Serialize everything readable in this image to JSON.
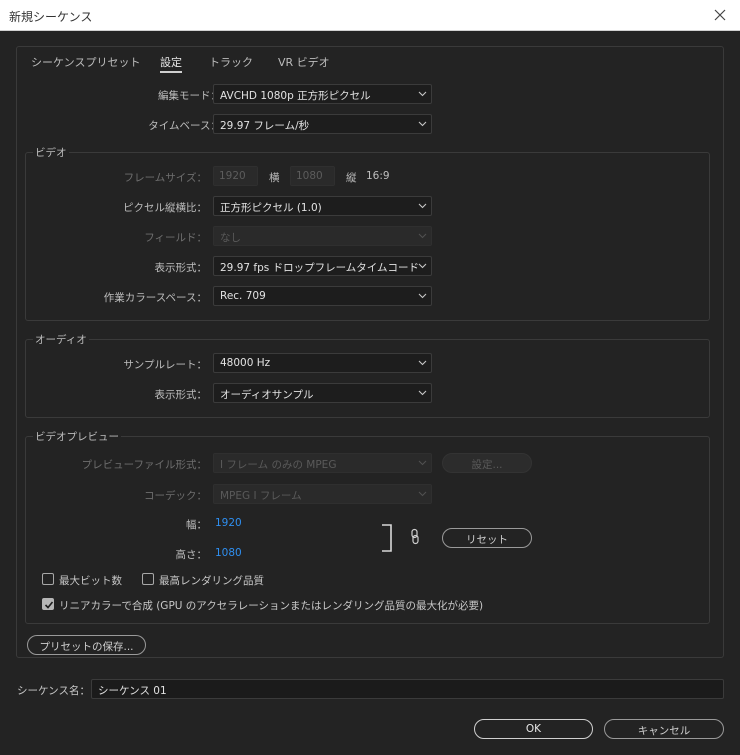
{
  "window": {
    "title": "新規シーケンス"
  },
  "tabs": [
    {
      "label": "シーケンスプリセット"
    },
    {
      "label": "設定"
    },
    {
      "label": "トラック"
    },
    {
      "label": "VR ビデオ"
    }
  ],
  "general": {
    "edit_mode_label": "編集モード：",
    "edit_mode_value": "AVCHD  1080p 正方形ピクセル",
    "timebase_label": "タイムベース：",
    "timebase_value": "29.97  フレーム/秒"
  },
  "video": {
    "title": "ビデオ",
    "frame_size_label": "フレームサイズ：",
    "frame_width": "1920",
    "horizontal_label": "横",
    "frame_height": "1080",
    "vertical_label": "縦",
    "aspect": "16:9",
    "pixel_aspect_label": "ピクセル縦横比：",
    "pixel_aspect_value": "正方形ピクセル (1.0)",
    "field_label": "フィールド：",
    "field_value": "なし",
    "display_format_label": "表示形式：",
    "display_format_value": "29.97  fps ドロップフレームタイムコード",
    "color_space_label": "作業カラースペース：",
    "color_space_value": "Rec. 709"
  },
  "audio": {
    "title": "オーディオ",
    "sample_rate_label": "サンプルレート：",
    "sample_rate_value": "48000 Hz",
    "display_format_label": "表示形式：",
    "display_format_value": "オーディオサンプル"
  },
  "preview": {
    "title": "ビデオプレビュー",
    "file_format_label": "プレビューファイル形式：",
    "file_format_value": "I フレーム のみの MPEG",
    "settings_button": "設定...",
    "codec_label": "コーデック：",
    "codec_value": "MPEG I フレーム",
    "width_label": "幅：",
    "width_value": "1920",
    "height_label": "高さ：",
    "height_value": "1080",
    "reset_button": "リセット",
    "max_bit_depth": "最大ビット数",
    "max_render_quality": "最高レンダリング品質",
    "linear_color": "リニアカラーで合成 (GPU のアクセラレーションまたはレンダリング品質の最大化が必要)"
  },
  "save_preset_button": "プリセットの保存...",
  "sequence_name_label": "シーケンス名：",
  "sequence_name_value": "シーケンス 01",
  "ok_button": "OK",
  "cancel_button": "キャンセル"
}
